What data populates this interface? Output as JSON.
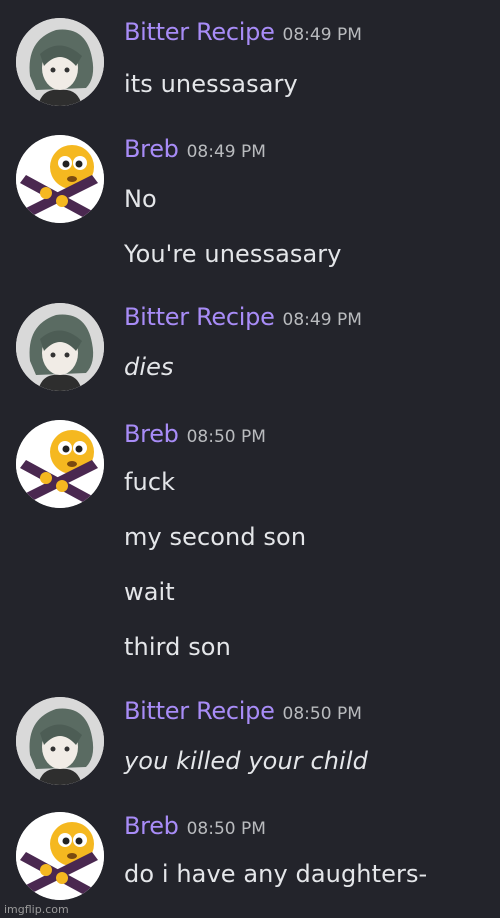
{
  "messages": [
    {
      "username": "Bitter Recipe",
      "time": "08:49 PM",
      "avatar": "anime-character-avatar",
      "lines": [
        "its unessasary"
      ],
      "italic": false
    },
    {
      "username": "Breb",
      "time": "08:49 PM",
      "avatar": "emoji-avatar",
      "lines": [
        "No",
        "You're unessasary"
      ],
      "italic": false
    },
    {
      "username": "Bitter Recipe",
      "time": "08:49 PM",
      "avatar": "anime-character-avatar",
      "lines": [
        "dies"
      ],
      "italic": true
    },
    {
      "username": "Breb",
      "time": "08:50 PM",
      "avatar": "emoji-avatar",
      "lines": [
        "fuck",
        "my second son",
        "wait",
        "third son"
      ],
      "italic": false
    },
    {
      "username": "Bitter Recipe",
      "time": "08:50 PM",
      "avatar": "anime-character-avatar",
      "lines": [
        "you killed your child"
      ],
      "italic": true
    },
    {
      "username": "Breb",
      "time": "08:50 PM",
      "avatar": "emoji-avatar",
      "lines": [
        "do i have any daughters-"
      ],
      "italic": false
    }
  ],
  "watermark": "imgflip.com",
  "colors": {
    "background": "#23242b",
    "username": "#a88cf7",
    "text": "#e4e6e9",
    "timestamp": "#b9bbbe"
  }
}
